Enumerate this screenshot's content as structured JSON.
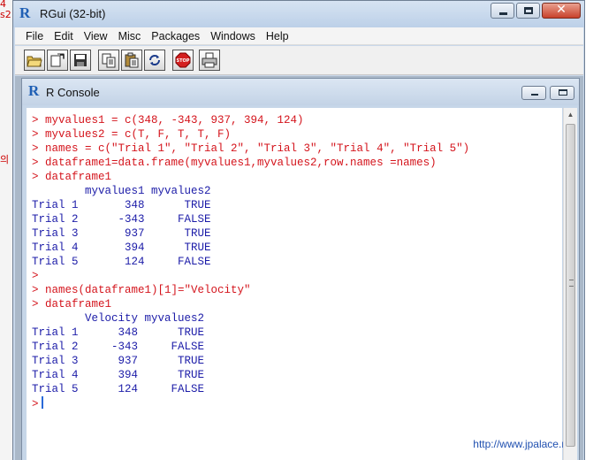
{
  "background": {
    "fragments": [
      "4",
      "s2",
      "의"
    ]
  },
  "window": {
    "title": "RGui (32-bit)",
    "menu": [
      "File",
      "Edit",
      "View",
      "Misc",
      "Packages",
      "Windows",
      "Help"
    ],
    "toolbar": [
      "open-script",
      "load-workspace",
      "save-workspace",
      "copy",
      "paste",
      "copy-paste",
      "stop",
      "print"
    ]
  },
  "console": {
    "title": "R Console",
    "lines": [
      {
        "kind": "input",
        "text": "> myvalues1 = c(348, -343, 937, 394, 124)"
      },
      {
        "kind": "input",
        "text": "> myvalues2 = c(T, F, T, T, F)"
      },
      {
        "kind": "input",
        "text": "> names = c(\"Trial 1\", \"Trial 2\", \"Trial 3\", \"Trial 4\", \"Trial 5\")"
      },
      {
        "kind": "input",
        "text": "> dataframe1=data.frame(myvalues1,myvalues2,row.names =names)"
      },
      {
        "kind": "input",
        "text": "> dataframe1"
      },
      {
        "kind": "output",
        "text": "        myvalues1 myvalues2"
      },
      {
        "kind": "output",
        "text": "Trial 1       348      TRUE"
      },
      {
        "kind": "output",
        "text": "Trial 2      -343     FALSE"
      },
      {
        "kind": "output",
        "text": "Trial 3       937      TRUE"
      },
      {
        "kind": "output",
        "text": "Trial 4       394      TRUE"
      },
      {
        "kind": "output",
        "text": "Trial 5       124     FALSE"
      },
      {
        "kind": "input",
        "text": ">"
      },
      {
        "kind": "input",
        "text": "> names(dataframe1)[1]=\"Velocity\""
      },
      {
        "kind": "input",
        "text": "> dataframe1"
      },
      {
        "kind": "output",
        "text": "        Velocity myvalues2"
      },
      {
        "kind": "output",
        "text": "Trial 1      348      TRUE"
      },
      {
        "kind": "output",
        "text": "Trial 2     -343     FALSE"
      },
      {
        "kind": "output",
        "text": "Trial 3      937      TRUE"
      },
      {
        "kind": "output",
        "text": "Trial 4      394      TRUE"
      },
      {
        "kind": "output",
        "text": "Trial 5      124     FALSE"
      }
    ],
    "prompt": ">",
    "watermark": "http://www.jpalace.net"
  },
  "colors": {
    "input": "#d4141c",
    "output": "#1c1ca8",
    "stop": "#d42020"
  }
}
